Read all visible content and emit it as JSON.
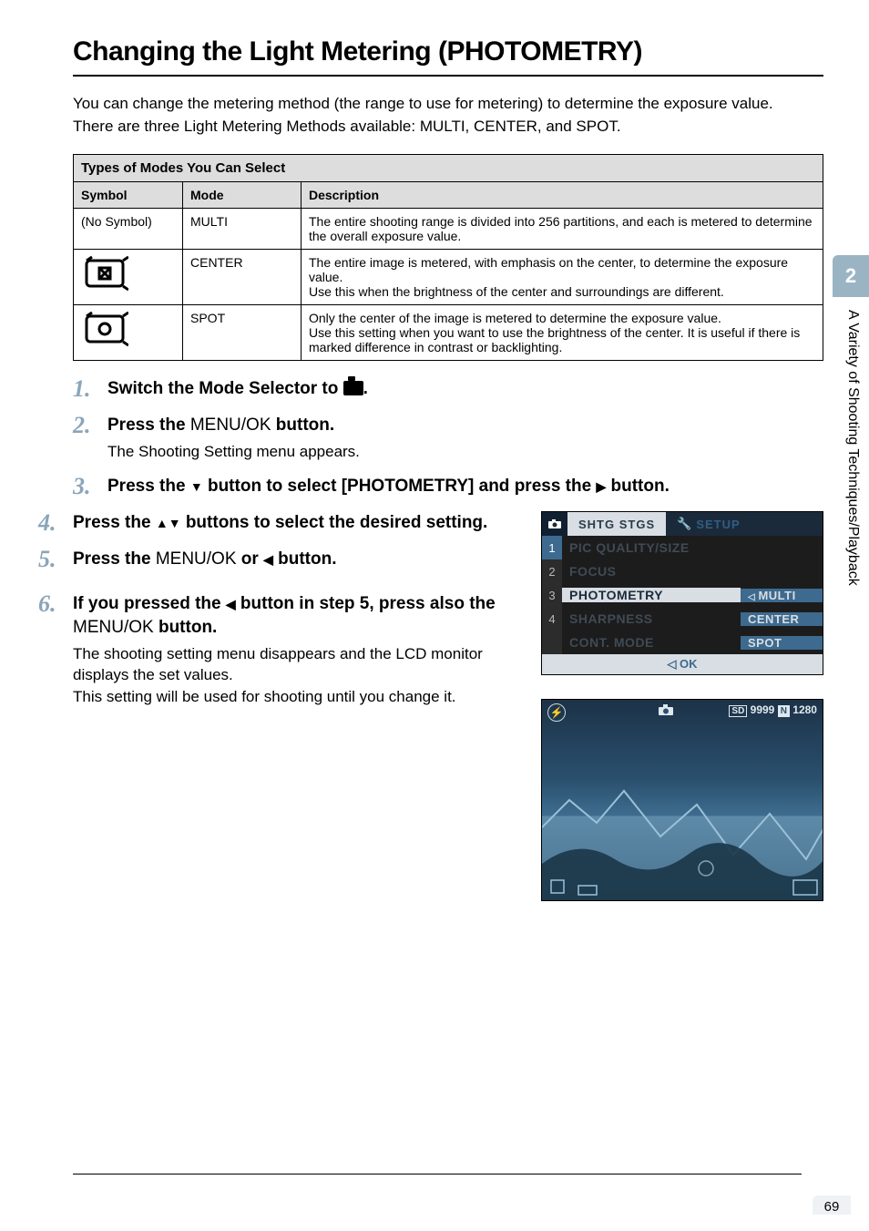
{
  "title": "Changing the Light Metering (PHOTOMETRY)",
  "intro_line1": "You can change the metering method (the range to use for metering) to determine the exposure value.",
  "intro_line2": "There are three Light Metering Methods available: MULTI, CENTER, and SPOT.",
  "table": {
    "caption": "Types of Modes You Can Select",
    "headers": {
      "symbol": "Symbol",
      "mode": "Mode",
      "desc": "Description"
    },
    "rows": [
      {
        "symbol": "(No Symbol)",
        "mode": "MULTI",
        "desc": "The entire shooting range is divided into 256 partitions, and each is metered to determine the overall exposure value."
      },
      {
        "symbol": "center-icon",
        "mode": "CENTER",
        "desc": "The entire image is metered, with emphasis on the center, to determine the exposure value.\nUse this when the brightness of the center and surroundings are different."
      },
      {
        "symbol": "spot-icon",
        "mode": "SPOT",
        "desc": "Only the center of the image is metered to determine the exposure value.\nUse this setting when you want to use the brightness of the center. It is useful if there is marked difference in contrast or backlighting."
      }
    ]
  },
  "steps": [
    {
      "title_pre": "Switch the Mode Selector to ",
      "title_post": ".",
      "body": ""
    },
    {
      "title_pre": "Press the ",
      "menu": "MENU/OK",
      "title_post": " button.",
      "body": "The Shooting Setting menu appears."
    },
    {
      "title_pre": "Press the ",
      "arrows": "down",
      "title_mid": " button to select [PHOTOMETRY] and press the ",
      "arrows2": "right",
      "title_post": " button.",
      "body": ""
    },
    {
      "title_pre": "Press the ",
      "arrows": "updown",
      "title_post": " buttons to select the desired setting.",
      "body": ""
    },
    {
      "title_pre": "Press the ",
      "menu": "MENU/OK",
      "title_mid": " or ",
      "arrows2": "left",
      "title_post": " button.",
      "body": ""
    },
    {
      "title_pre": "If you pressed the ",
      "arrows": "left",
      "title_mid": " button in step 5, press also the ",
      "menu": "MENU/OK",
      "title_post": " button.",
      "body": "The shooting setting menu disappears and the LCD monitor displays the set values.\nThis setting will be used for shooting until you change it."
    }
  ],
  "lcd": {
    "tab1": "SHTG STGS",
    "tab2": "SETUP",
    "rows": [
      {
        "num": "1",
        "label": "PIC QUALITY/SIZE",
        "value": ""
      },
      {
        "num": "2",
        "label": "FOCUS",
        "value": ""
      },
      {
        "num": "3",
        "label": "PHOTOMETRY",
        "value": "MULTI",
        "active": true
      },
      {
        "num": "4",
        "label": "SHARPNESS",
        "value": "CENTER"
      },
      {
        "num": "",
        "label": "CONT. MODE",
        "value": "SPOT"
      }
    ],
    "ok": "OK"
  },
  "preview": {
    "sd": "SD",
    "count": "9999",
    "n": "N",
    "size": "1280"
  },
  "side": {
    "chapter": "2",
    "text": "A Variety of Shooting Techniques/Playback"
  },
  "page_number": "69"
}
